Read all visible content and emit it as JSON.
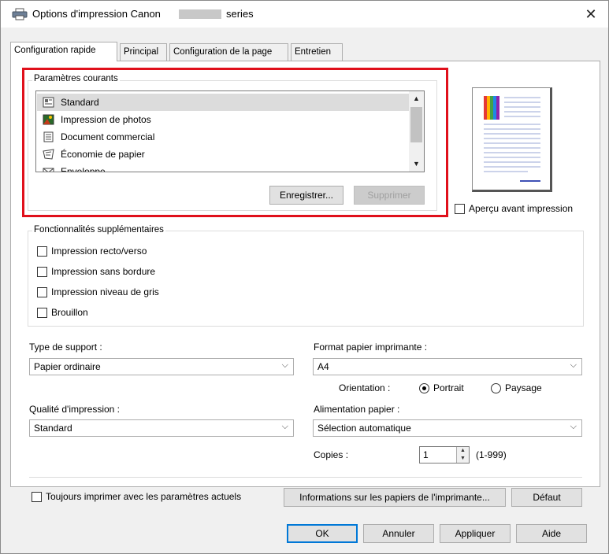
{
  "window": {
    "title": "Options d'impression Canon",
    "title_suffix": "series",
    "close_icon": "close-icon"
  },
  "tabs": [
    {
      "label": "Configuration rapide",
      "active": true
    },
    {
      "label": "Principal",
      "active": false
    },
    {
      "label": "Configuration de la page",
      "active": false
    },
    {
      "label": "Entretien",
      "active": false
    }
  ],
  "current_settings": {
    "group_label": "Paramètres courants",
    "items": [
      {
        "label": "Standard",
        "selected": true,
        "icon": "standard-doc-icon"
      },
      {
        "label": "Impression de photos",
        "selected": false,
        "icon": "photo-icon"
      },
      {
        "label": "Document commercial",
        "selected": false,
        "icon": "business-doc-icon"
      },
      {
        "label": "Économie de papier",
        "selected": false,
        "icon": "paper-saving-icon"
      },
      {
        "label": "Enveloppe",
        "selected": false,
        "icon": "envelope-icon"
      }
    ],
    "save_button": "Enregistrer...",
    "delete_button": "Supprimer"
  },
  "preview": {
    "checkbox_label": "Aperçu avant impression",
    "checked": false
  },
  "additional_features": {
    "group_label": "Fonctionnalités supplémentaires",
    "items": [
      {
        "label": "Impression recto/verso",
        "checked": false
      },
      {
        "label": "Impression sans bordure",
        "checked": false
      },
      {
        "label": "Impression niveau de gris",
        "checked": false
      },
      {
        "label": "Brouillon",
        "checked": false
      }
    ]
  },
  "media_type": {
    "label": "Type de support :",
    "value": "Papier ordinaire"
  },
  "paper_size": {
    "label": "Format papier imprimante :",
    "value": "A4"
  },
  "orientation": {
    "label": "Orientation :",
    "portrait": "Portrait",
    "landscape": "Paysage",
    "selected": "portrait"
  },
  "print_quality": {
    "label": "Qualité d'impression :",
    "value": "Standard"
  },
  "paper_source": {
    "label": "Alimentation papier :",
    "value": "Sélection automatique"
  },
  "copies": {
    "label": "Copies :",
    "value": "1",
    "range": "(1-999)"
  },
  "always_print": {
    "label": "Toujours imprimer avec les paramètres actuels",
    "checked": false
  },
  "paper_info_button": "Informations sur les papiers de l'imprimante...",
  "default_button": "Défaut",
  "footer": {
    "ok": "OK",
    "cancel": "Annuler",
    "apply": "Appliquer",
    "help": "Aide"
  },
  "colors": {
    "highlight_box": "#e0101b",
    "selected_row": "#dcdcdc",
    "default_button_border": "#0078d7"
  }
}
